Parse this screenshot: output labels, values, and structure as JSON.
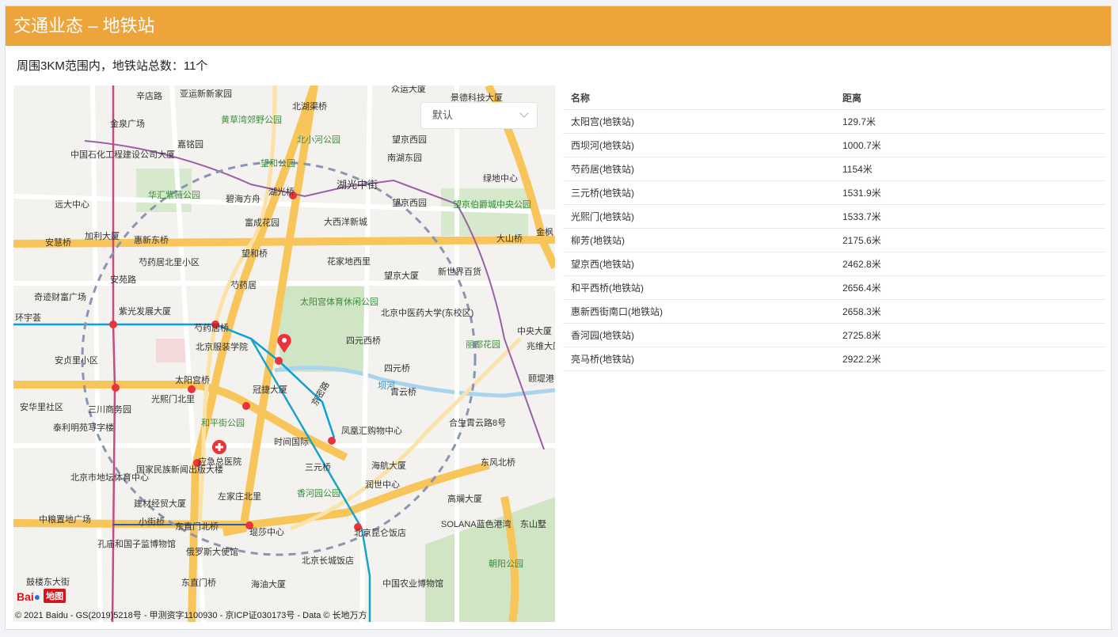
{
  "header": {
    "title": "交通业态 – 地铁站"
  },
  "summary": "周围3KM范围内，地铁站总数：11个",
  "map": {
    "select_value": "默认",
    "logo_text": "Bai",
    "logo_badge": "地图",
    "copyright": "© 2021 Baidu - GS(2019)5218号 - 甲测资字1100930 - 京ICP证030173号 - Data © 长地万方",
    "labels": [
      "辛店路",
      "亚运新新家园",
      "北湖渠桥",
      "众运大厦",
      "景德科技大厦",
      "金泉广场",
      "黄草湾郊野公园",
      "北小河公园",
      "嘉铭园",
      "望京西园",
      "中国石化工程建设公司大厦",
      "望和公园",
      "南湖东园",
      "华汇紫薇公园",
      "碧海方舟",
      "湖光桥",
      "湖光中街",
      "绿地中心",
      "远大中心",
      "望京西园",
      "望京伯爵城中央公园",
      "富成花园",
      "大西洋新城",
      "加利大厦",
      "安慧桥",
      "惠新东桥",
      "大山桥",
      "金枫",
      "芍药居北里小区",
      "望和桥",
      "花家地西里",
      "望京大厦",
      "新世界百货",
      "安苑路",
      "芍药居",
      "奇迹财富广场",
      "紫光发展大厦",
      "太阳宫体育休闲公园",
      "北京中医药大学(东校区)",
      "环宇荟",
      "芍药居桥",
      "中央大厦",
      "北京服装学院",
      "四元西桥",
      "丽都花园",
      "兆维大厦",
      "安贞里小区",
      "四元桥",
      "颐堤港",
      "太阳宫桥",
      "冠捷大厦",
      "霄云桥",
      "坝河",
      "安华里社区",
      "三川商务园",
      "光熙门北里",
      "京密路",
      "和平街公园",
      "合生霄云路8号",
      "泰利明苑写字楼",
      "时间国际",
      "凤凰汇购物中心",
      "应急总医院",
      "三元桥",
      "东风北桥",
      "国家民族新闻出版大楼",
      "海航大厦",
      "北京市地坛体育中心",
      "左家庄北里",
      "润世中心",
      "建材经贸大厦",
      "香河园公园",
      "高斓大厦",
      "中粮置地广场",
      "小街桥",
      "东直门北桥",
      "琨莎中心",
      "北京昆仑饭店",
      "SOLANA蓝色港湾",
      "东山墅",
      "孔庙和国子监博物馆",
      "俄罗斯大使馆",
      "北京长城饭店",
      "朝阳公园",
      "鼓楼东大街",
      "东直门桥",
      "海油大厦",
      "中国农业博物馆"
    ]
  },
  "table": {
    "headers": {
      "name": "名称",
      "distance": "距离"
    },
    "rows": [
      {
        "name": "太阳宫(地铁站)",
        "distance": "129.7米"
      },
      {
        "name": "西坝河(地铁站)",
        "distance": "1000.7米"
      },
      {
        "name": "芍药居(地铁站)",
        "distance": "1154米"
      },
      {
        "name": "三元桥(地铁站)",
        "distance": "1531.9米"
      },
      {
        "name": "光熙门(地铁站)",
        "distance": "1533.7米"
      },
      {
        "name": "柳芳(地铁站)",
        "distance": "2175.6米"
      },
      {
        "name": "望京西(地铁站)",
        "distance": "2462.8米"
      },
      {
        "name": "和平西桥(地铁站)",
        "distance": "2656.4米"
      },
      {
        "name": "惠新西街南口(地铁站)",
        "distance": "2658.3米"
      },
      {
        "name": "香河园(地铁站)",
        "distance": "2725.8米"
      },
      {
        "name": "亮马桥(地铁站)",
        "distance": "2922.2米"
      }
    ]
  },
  "colors": {
    "header": "#eda43b",
    "station": "#e8343a",
    "radius": "#8a95b3",
    "park": "#cfe5c4"
  }
}
